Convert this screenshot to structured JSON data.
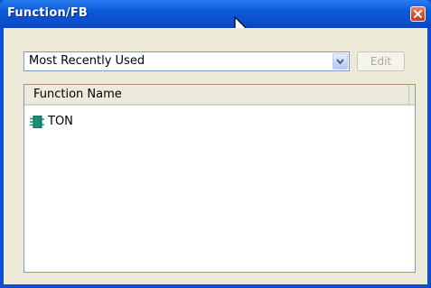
{
  "window": {
    "title": "Function/FB"
  },
  "filter": {
    "selected": "Most Recently Used"
  },
  "toolbar": {
    "edit_label": "Edit"
  },
  "list": {
    "column_header": "Function Name",
    "items": [
      {
        "label": "TON",
        "icon": "function-block-icon"
      }
    ]
  },
  "colors": {
    "titlebar": "#0a5ad8",
    "frame": "#0a4fd6",
    "client_bg": "#ece9d8",
    "close_button": "#d8502a",
    "fb_icon": "#1a8c7a"
  }
}
